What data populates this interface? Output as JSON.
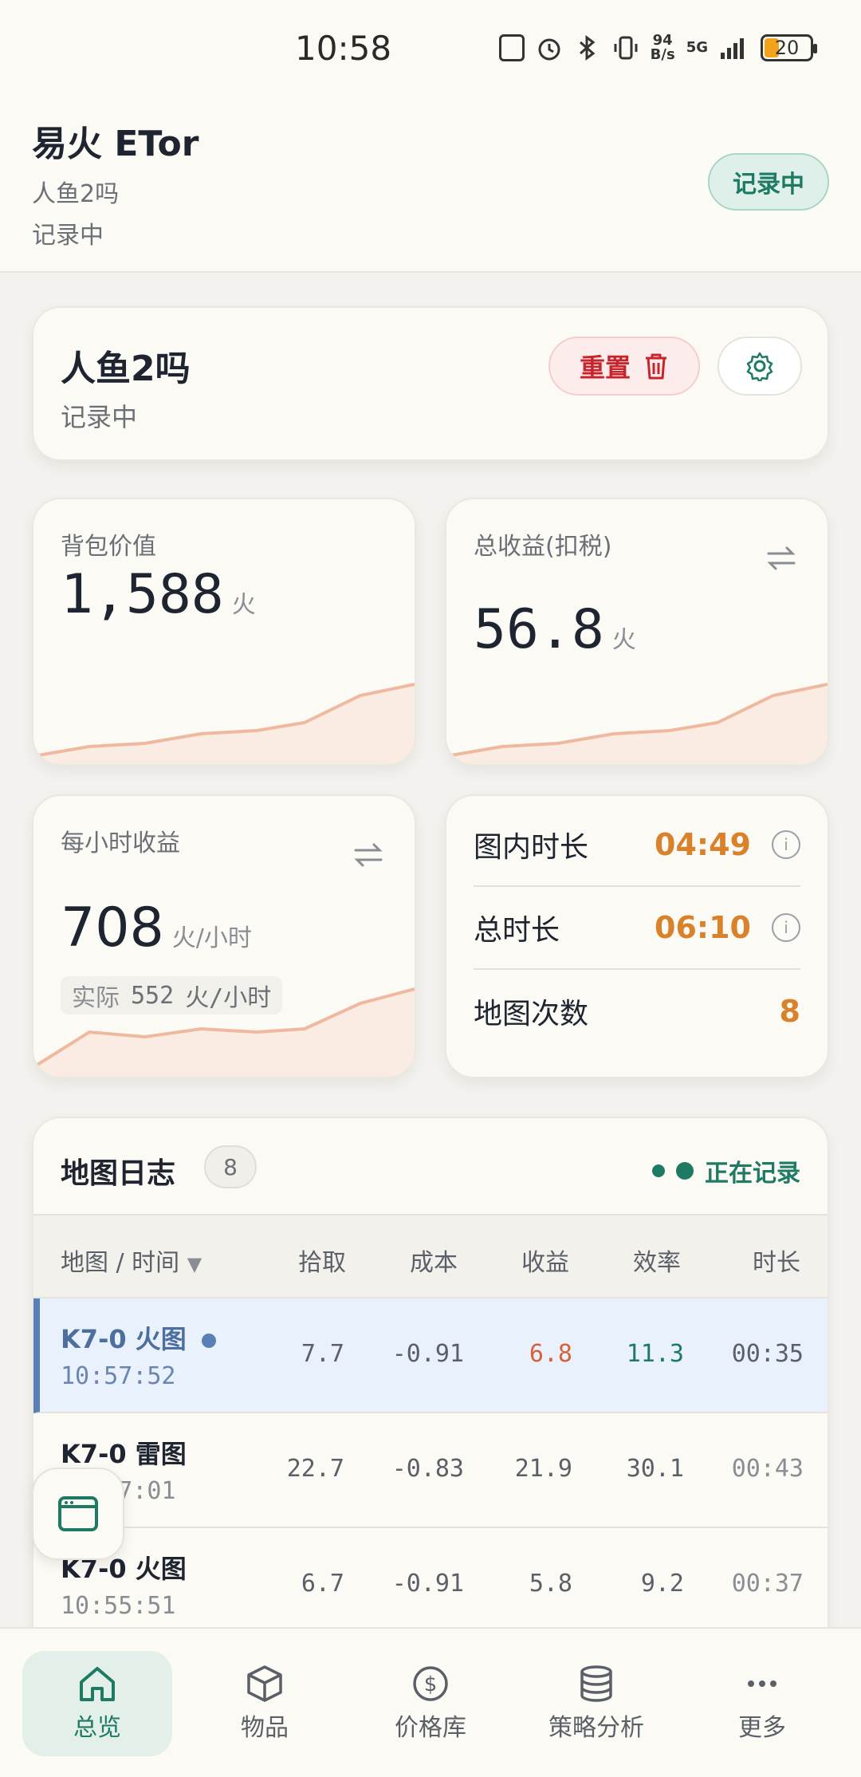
{
  "status_bar": {
    "time": "10:58",
    "net_speed_top": "94",
    "net_speed_bottom": "B/s",
    "net_type": "5G",
    "battery": "20"
  },
  "header": {
    "title": "易火 ETor",
    "subtitle": "人鱼2吗",
    "status": "记录中",
    "badge": "记录中"
  },
  "session": {
    "name": "人鱼2吗",
    "status": "记录中",
    "reset_label": "重置"
  },
  "stats": {
    "bag_value": {
      "label": "背包价值",
      "value": "1,588",
      "unit": "火"
    },
    "total_income": {
      "label": "总收益(扣税)",
      "value": "56.8",
      "unit": "火"
    },
    "hourly": {
      "label": "每小时收益",
      "value": "708",
      "unit": "火/小时",
      "actual_label": "实际",
      "actual_value": "552",
      "actual_unit": "火/小时"
    },
    "time": {
      "in_map_label": "图内时长",
      "in_map_value": "04:49",
      "total_label": "总时长",
      "total_value": "06:10",
      "map_count_label": "地图次数",
      "map_count_value": "8"
    }
  },
  "log": {
    "title": "地图日志",
    "count": "8",
    "live_label": "正在记录",
    "columns": [
      "地图 / 时间",
      "拾取",
      "成本",
      "收益",
      "效率",
      "时长"
    ],
    "rows": [
      {
        "map": "K7-0 火图",
        "time": "10:57:52",
        "pickup": "7.7",
        "cost": "-0.91",
        "income": "6.8",
        "eff": "11.3",
        "dur": "00:35"
      },
      {
        "map": "K7-0 雷图",
        "time": "10:57:01",
        "pickup": "22.7",
        "cost": "-0.83",
        "income": "21.9",
        "eff": "30.1",
        "dur": "00:43"
      },
      {
        "map": "K7-0 火图",
        "time": "10:55:51",
        "pickup": "6.7",
        "cost": "-0.91",
        "income": "5.8",
        "eff": "9.2",
        "dur": "00:37"
      }
    ]
  },
  "nav": [
    "总览",
    "物品",
    "价格库",
    "策略分析",
    "更多"
  ],
  "colors": {
    "accent": "#1e7a63",
    "danger": "#c8242c",
    "warn": "#d9822b",
    "active_row": "#e8f1fc"
  }
}
